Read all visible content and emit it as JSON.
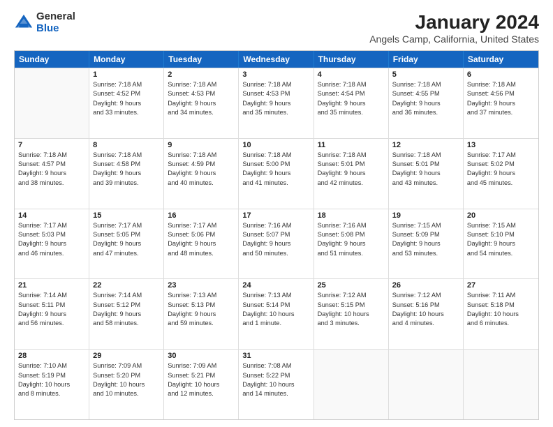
{
  "logo": {
    "general": "General",
    "blue": "Blue"
  },
  "title": "January 2024",
  "subtitle": "Angels Camp, California, United States",
  "header_days": [
    "Sunday",
    "Monday",
    "Tuesday",
    "Wednesday",
    "Thursday",
    "Friday",
    "Saturday"
  ],
  "weeks": [
    [
      {
        "day": "",
        "lines": []
      },
      {
        "day": "1",
        "lines": [
          "Sunrise: 7:18 AM",
          "Sunset: 4:52 PM",
          "Daylight: 9 hours",
          "and 33 minutes."
        ]
      },
      {
        "day": "2",
        "lines": [
          "Sunrise: 7:18 AM",
          "Sunset: 4:53 PM",
          "Daylight: 9 hours",
          "and 34 minutes."
        ]
      },
      {
        "day": "3",
        "lines": [
          "Sunrise: 7:18 AM",
          "Sunset: 4:53 PM",
          "Daylight: 9 hours",
          "and 35 minutes."
        ]
      },
      {
        "day": "4",
        "lines": [
          "Sunrise: 7:18 AM",
          "Sunset: 4:54 PM",
          "Daylight: 9 hours",
          "and 35 minutes."
        ]
      },
      {
        "day": "5",
        "lines": [
          "Sunrise: 7:18 AM",
          "Sunset: 4:55 PM",
          "Daylight: 9 hours",
          "and 36 minutes."
        ]
      },
      {
        "day": "6",
        "lines": [
          "Sunrise: 7:18 AM",
          "Sunset: 4:56 PM",
          "Daylight: 9 hours",
          "and 37 minutes."
        ]
      }
    ],
    [
      {
        "day": "7",
        "lines": [
          "Sunrise: 7:18 AM",
          "Sunset: 4:57 PM",
          "Daylight: 9 hours",
          "and 38 minutes."
        ]
      },
      {
        "day": "8",
        "lines": [
          "Sunrise: 7:18 AM",
          "Sunset: 4:58 PM",
          "Daylight: 9 hours",
          "and 39 minutes."
        ]
      },
      {
        "day": "9",
        "lines": [
          "Sunrise: 7:18 AM",
          "Sunset: 4:59 PM",
          "Daylight: 9 hours",
          "and 40 minutes."
        ]
      },
      {
        "day": "10",
        "lines": [
          "Sunrise: 7:18 AM",
          "Sunset: 5:00 PM",
          "Daylight: 9 hours",
          "and 41 minutes."
        ]
      },
      {
        "day": "11",
        "lines": [
          "Sunrise: 7:18 AM",
          "Sunset: 5:01 PM",
          "Daylight: 9 hours",
          "and 42 minutes."
        ]
      },
      {
        "day": "12",
        "lines": [
          "Sunrise: 7:18 AM",
          "Sunset: 5:01 PM",
          "Daylight: 9 hours",
          "and 43 minutes."
        ]
      },
      {
        "day": "13",
        "lines": [
          "Sunrise: 7:17 AM",
          "Sunset: 5:02 PM",
          "Daylight: 9 hours",
          "and 45 minutes."
        ]
      }
    ],
    [
      {
        "day": "14",
        "lines": [
          "Sunrise: 7:17 AM",
          "Sunset: 5:03 PM",
          "Daylight: 9 hours",
          "and 46 minutes."
        ]
      },
      {
        "day": "15",
        "lines": [
          "Sunrise: 7:17 AM",
          "Sunset: 5:05 PM",
          "Daylight: 9 hours",
          "and 47 minutes."
        ]
      },
      {
        "day": "16",
        "lines": [
          "Sunrise: 7:17 AM",
          "Sunset: 5:06 PM",
          "Daylight: 9 hours",
          "and 48 minutes."
        ]
      },
      {
        "day": "17",
        "lines": [
          "Sunrise: 7:16 AM",
          "Sunset: 5:07 PM",
          "Daylight: 9 hours",
          "and 50 minutes."
        ]
      },
      {
        "day": "18",
        "lines": [
          "Sunrise: 7:16 AM",
          "Sunset: 5:08 PM",
          "Daylight: 9 hours",
          "and 51 minutes."
        ]
      },
      {
        "day": "19",
        "lines": [
          "Sunrise: 7:15 AM",
          "Sunset: 5:09 PM",
          "Daylight: 9 hours",
          "and 53 minutes."
        ]
      },
      {
        "day": "20",
        "lines": [
          "Sunrise: 7:15 AM",
          "Sunset: 5:10 PM",
          "Daylight: 9 hours",
          "and 54 minutes."
        ]
      }
    ],
    [
      {
        "day": "21",
        "lines": [
          "Sunrise: 7:14 AM",
          "Sunset: 5:11 PM",
          "Daylight: 9 hours",
          "and 56 minutes."
        ]
      },
      {
        "day": "22",
        "lines": [
          "Sunrise: 7:14 AM",
          "Sunset: 5:12 PM",
          "Daylight: 9 hours",
          "and 58 minutes."
        ]
      },
      {
        "day": "23",
        "lines": [
          "Sunrise: 7:13 AM",
          "Sunset: 5:13 PM",
          "Daylight: 9 hours",
          "and 59 minutes."
        ]
      },
      {
        "day": "24",
        "lines": [
          "Sunrise: 7:13 AM",
          "Sunset: 5:14 PM",
          "Daylight: 10 hours",
          "and 1 minute."
        ]
      },
      {
        "day": "25",
        "lines": [
          "Sunrise: 7:12 AM",
          "Sunset: 5:15 PM",
          "Daylight: 10 hours",
          "and 3 minutes."
        ]
      },
      {
        "day": "26",
        "lines": [
          "Sunrise: 7:12 AM",
          "Sunset: 5:16 PM",
          "Daylight: 10 hours",
          "and 4 minutes."
        ]
      },
      {
        "day": "27",
        "lines": [
          "Sunrise: 7:11 AM",
          "Sunset: 5:18 PM",
          "Daylight: 10 hours",
          "and 6 minutes."
        ]
      }
    ],
    [
      {
        "day": "28",
        "lines": [
          "Sunrise: 7:10 AM",
          "Sunset: 5:19 PM",
          "Daylight: 10 hours",
          "and 8 minutes."
        ]
      },
      {
        "day": "29",
        "lines": [
          "Sunrise: 7:09 AM",
          "Sunset: 5:20 PM",
          "Daylight: 10 hours",
          "and 10 minutes."
        ]
      },
      {
        "day": "30",
        "lines": [
          "Sunrise: 7:09 AM",
          "Sunset: 5:21 PM",
          "Daylight: 10 hours",
          "and 12 minutes."
        ]
      },
      {
        "day": "31",
        "lines": [
          "Sunrise: 7:08 AM",
          "Sunset: 5:22 PM",
          "Daylight: 10 hours",
          "and 14 minutes."
        ]
      },
      {
        "day": "",
        "lines": []
      },
      {
        "day": "",
        "lines": []
      },
      {
        "day": "",
        "lines": []
      }
    ]
  ]
}
